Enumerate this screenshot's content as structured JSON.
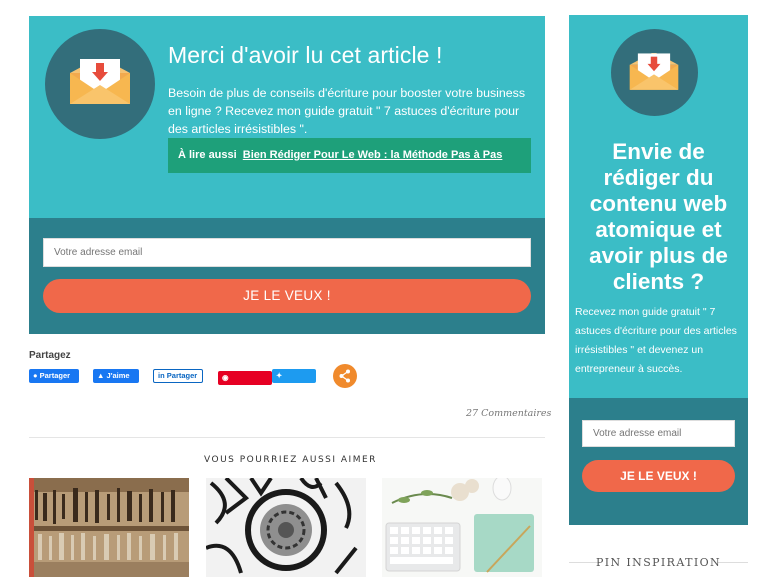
{
  "optin_main": {
    "title": "Merci d'avoir lu cet article !",
    "text": "Besoin de plus de conseils d'écriture pour booster votre business en ligne ? Recevez mon guide gratuit \" 7 astuces d'écriture pour des articles irrésistibles \".",
    "read_also_label": "À lire aussi",
    "read_also_link": "Bien Rédiger Pour Le Web : la Méthode Pas à Pas",
    "email_placeholder": "Votre adresse email",
    "button": "JE LE VEUX !"
  },
  "share": {
    "title": "Partagez",
    "facebook": "Partager",
    "like": "J'aime",
    "linkedin": "Partager",
    "pinterest": "Enregistrer",
    "twitter": "Tweeter"
  },
  "comments": "27 Commentaires",
  "related": {
    "title": "VOUS POURRIEZ AUSSI AIMER"
  },
  "sidebar": {
    "title": "Envie de rédiger du contenu web atomique et avoir plus de clients ?",
    "text": "Recevez mon guide gratuit \" 7 astuces d'écriture pour des articles irrésistibles \" et devenez un entrepreneur à succès.",
    "email_placeholder": "Votre adresse email",
    "button": "JE LE VEUX !",
    "pin_title": "PIN INSPIRATION"
  },
  "colors": {
    "teal": "#3bbdc6",
    "dark_teal": "#2c7f8c",
    "orange_button": "#f0684a",
    "green_box": "#1ea07a"
  }
}
